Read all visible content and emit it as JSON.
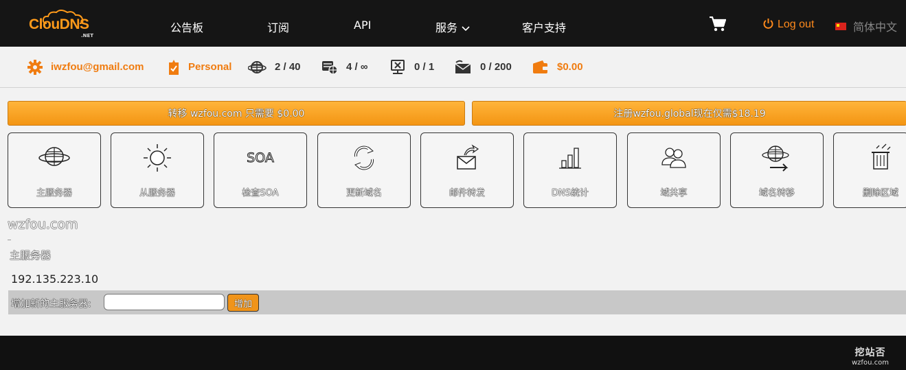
{
  "brand": {
    "logo_text": "ClouDNS",
    "logo_sub": ".NET"
  },
  "nav": {
    "items": [
      {
        "label": "公告板"
      },
      {
        "label": "订阅"
      },
      {
        "label": "API"
      },
      {
        "label": "服务"
      },
      {
        "label": "客户支持"
      }
    ],
    "logout": "Log out",
    "language": "简体中文"
  },
  "stats": {
    "email": "iwzfou@gmail.com",
    "plan": "Personal",
    "zones": "2 / 40",
    "records": "4 / ∞",
    "mail_forwards": "0 / 1",
    "web_redirects": "0 / 200",
    "balance": "$0.00"
  },
  "promos": {
    "transfer": "转移 wzfou.com 只需要 $0.00",
    "register": "注册wzfou.global现在仅需$18.19"
  },
  "tiles": [
    {
      "label": "主服务器",
      "icon": "globe-icon"
    },
    {
      "label": "从服务器",
      "icon": "sun-icon"
    },
    {
      "label": "检查SOA",
      "icon": "soa-icon"
    },
    {
      "label": "更新域名",
      "icon": "refresh-icon"
    },
    {
      "label": "邮件转发",
      "icon": "mail-forward-icon"
    },
    {
      "label": "DNS统计",
      "icon": "bar-chart-icon"
    },
    {
      "label": "域共享",
      "icon": "users-icon"
    },
    {
      "label": "域名转移",
      "icon": "globe-arrow-icon"
    },
    {
      "label": "删除区域",
      "icon": "trash-icon"
    }
  ],
  "main": {
    "domain": "wzfou.com",
    "section_title": "主服务器",
    "ip": "192.135.223.10",
    "add_label": "增加新的主服务器:",
    "add_value": "",
    "add_button": "增加"
  },
  "watermark": {
    "line1": "挖站否",
    "line2": "wzfou.com"
  },
  "colors": {
    "accent": "#f07c10",
    "nav_bg": "#151515",
    "footer_bg": "#111111"
  }
}
